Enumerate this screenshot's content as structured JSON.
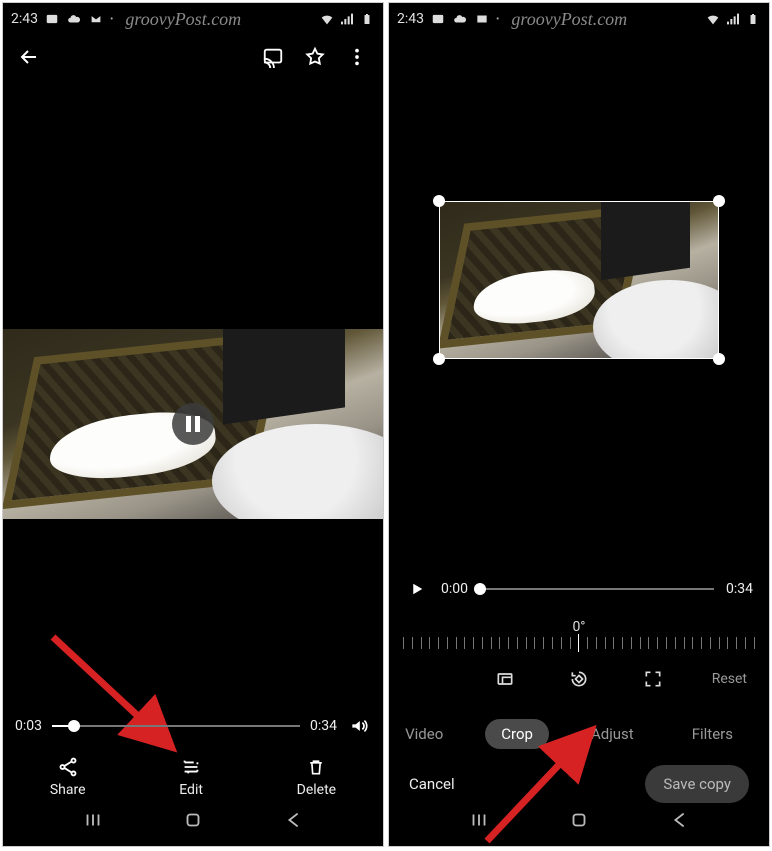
{
  "status": {
    "time": "2:43",
    "watermark": "groovyPost.com"
  },
  "phone1": {
    "scrubber": {
      "current": "0:03",
      "duration": "0:34",
      "progress_pct": 9
    },
    "actions": {
      "share": "Share",
      "edit": "Edit",
      "delete": "Delete"
    }
  },
  "phone2": {
    "scrubber": {
      "current": "0:00",
      "duration": "0:34",
      "progress_pct": 0
    },
    "rotation_degrees": "0°",
    "reset": "Reset",
    "tabs": {
      "video": "Video",
      "crop": "Crop",
      "adjust": "Adjust",
      "filters": "Filters"
    },
    "confirm": {
      "cancel": "Cancel",
      "save": "Save copy"
    }
  }
}
